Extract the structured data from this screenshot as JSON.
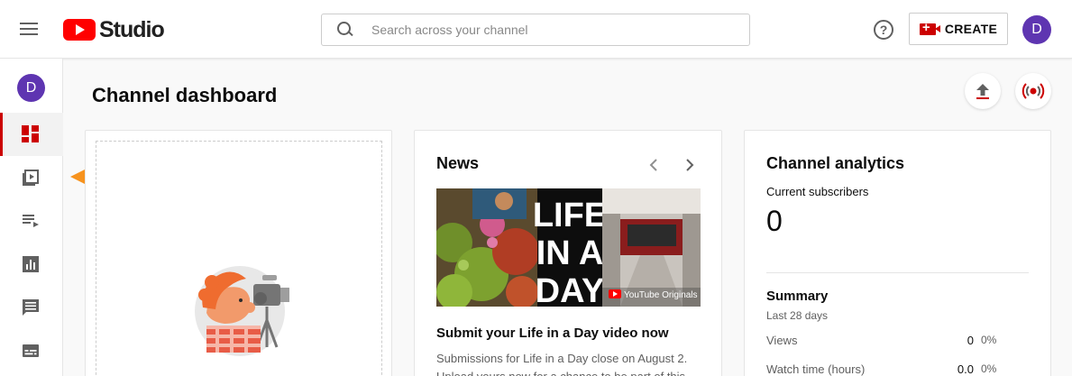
{
  "header": {
    "logo_text": "Studio",
    "search_placeholder": "Search across your channel",
    "help_glyph": "?",
    "create_label": "CREATE",
    "avatar_initial": "D"
  },
  "sidebar": {
    "avatar_initial": "D",
    "items": [
      {
        "name": "dashboard",
        "icon": "dashboard-icon",
        "active": true
      },
      {
        "name": "videos",
        "icon": "video-play-icon",
        "active": false
      },
      {
        "name": "playlists",
        "icon": "playlist-icon",
        "active": false
      },
      {
        "name": "analytics",
        "icon": "bar-chart-icon",
        "active": false
      },
      {
        "name": "comments",
        "icon": "comment-icon",
        "active": false
      },
      {
        "name": "subtitles",
        "icon": "subtitles-icon",
        "active": false
      }
    ]
  },
  "annotation": {
    "color": "#f7931e"
  },
  "main": {
    "title": "Channel dashboard",
    "news": {
      "title": "News",
      "image_words": [
        "LIFE",
        "IN A",
        "DAY"
      ],
      "image_brand": "YouTube Originals",
      "headline": "Submit your Life in a Day video now",
      "body": "Submissions for Life in a Day close on August 2. Upload yours now for a chance to be part of this"
    },
    "analytics": {
      "title": "Channel analytics",
      "subscribers_label": "Current subscribers",
      "subscribers_value": "0",
      "summary_title": "Summary",
      "summary_period": "Last 28 days",
      "metrics": [
        {
          "label": "Views",
          "value": "0",
          "pct": "0%"
        },
        {
          "label": "Watch time (hours)",
          "value": "0.0",
          "pct": "0%"
        }
      ]
    }
  },
  "colors": {
    "brand_red": "#ff0000",
    "active_red": "#cc0000",
    "avatar_purple": "#5e35b1"
  }
}
